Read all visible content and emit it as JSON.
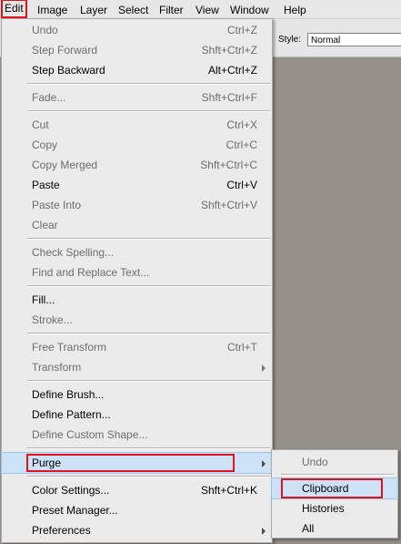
{
  "menubar": {
    "items": [
      "Edit",
      "Image",
      "Layer",
      "Select",
      "Filter",
      "View",
      "Window",
      "Help"
    ]
  },
  "options": {
    "style_label": "Style:",
    "style_value": "Normal"
  },
  "edit_menu": {
    "items": [
      {
        "label": "Undo",
        "shortcut": "Ctrl+Z",
        "enabled": false
      },
      {
        "label": "Step Forward",
        "shortcut": "Shft+Ctrl+Z",
        "enabled": false
      },
      {
        "label": "Step Backward",
        "shortcut": "Alt+Ctrl+Z",
        "enabled": true
      },
      {
        "label": "Fade...",
        "shortcut": "Shft+Ctrl+F",
        "enabled": false
      },
      {
        "label": "Cut",
        "shortcut": "Ctrl+X",
        "enabled": false
      },
      {
        "label": "Copy",
        "shortcut": "Ctrl+C",
        "enabled": false
      },
      {
        "label": "Copy Merged",
        "shortcut": "Shft+Ctrl+C",
        "enabled": false
      },
      {
        "label": "Paste",
        "shortcut": "Ctrl+V",
        "enabled": true
      },
      {
        "label": "Paste Into",
        "shortcut": "Shft+Ctrl+V",
        "enabled": false
      },
      {
        "label": "Clear",
        "shortcut": "",
        "enabled": false
      },
      {
        "label": "Check Spelling...",
        "shortcut": "",
        "enabled": false
      },
      {
        "label": "Find and Replace Text...",
        "shortcut": "",
        "enabled": false
      },
      {
        "label": "Fill...",
        "shortcut": "",
        "enabled": true
      },
      {
        "label": "Stroke...",
        "shortcut": "",
        "enabled": false
      },
      {
        "label": "Free Transform",
        "shortcut": "Ctrl+T",
        "enabled": false
      },
      {
        "label": "Transform",
        "shortcut": "",
        "enabled": false
      },
      {
        "label": "Define Brush...",
        "shortcut": "",
        "enabled": true
      },
      {
        "label": "Define Pattern...",
        "shortcut": "",
        "enabled": true
      },
      {
        "label": "Define Custom Shape...",
        "shortcut": "",
        "enabled": false
      },
      {
        "label": "Purge",
        "shortcut": "",
        "enabled": true
      },
      {
        "label": "Color Settings...",
        "shortcut": "Shft+Ctrl+K",
        "enabled": true
      },
      {
        "label": "Preset Manager...",
        "shortcut": "",
        "enabled": true
      },
      {
        "label": "Preferences",
        "shortcut": "",
        "enabled": true
      }
    ]
  },
  "purge_submenu": {
    "items": [
      {
        "label": "Undo",
        "enabled": false
      },
      {
        "label": "Clipboard",
        "enabled": true
      },
      {
        "label": "Histories",
        "enabled": true
      },
      {
        "label": "All",
        "enabled": true
      }
    ]
  },
  "colors": {
    "highlight_outline": "#e0131d",
    "selection": "#cde1f7",
    "disabled_text": "#6d6d6d",
    "workspace": "#959089"
  }
}
